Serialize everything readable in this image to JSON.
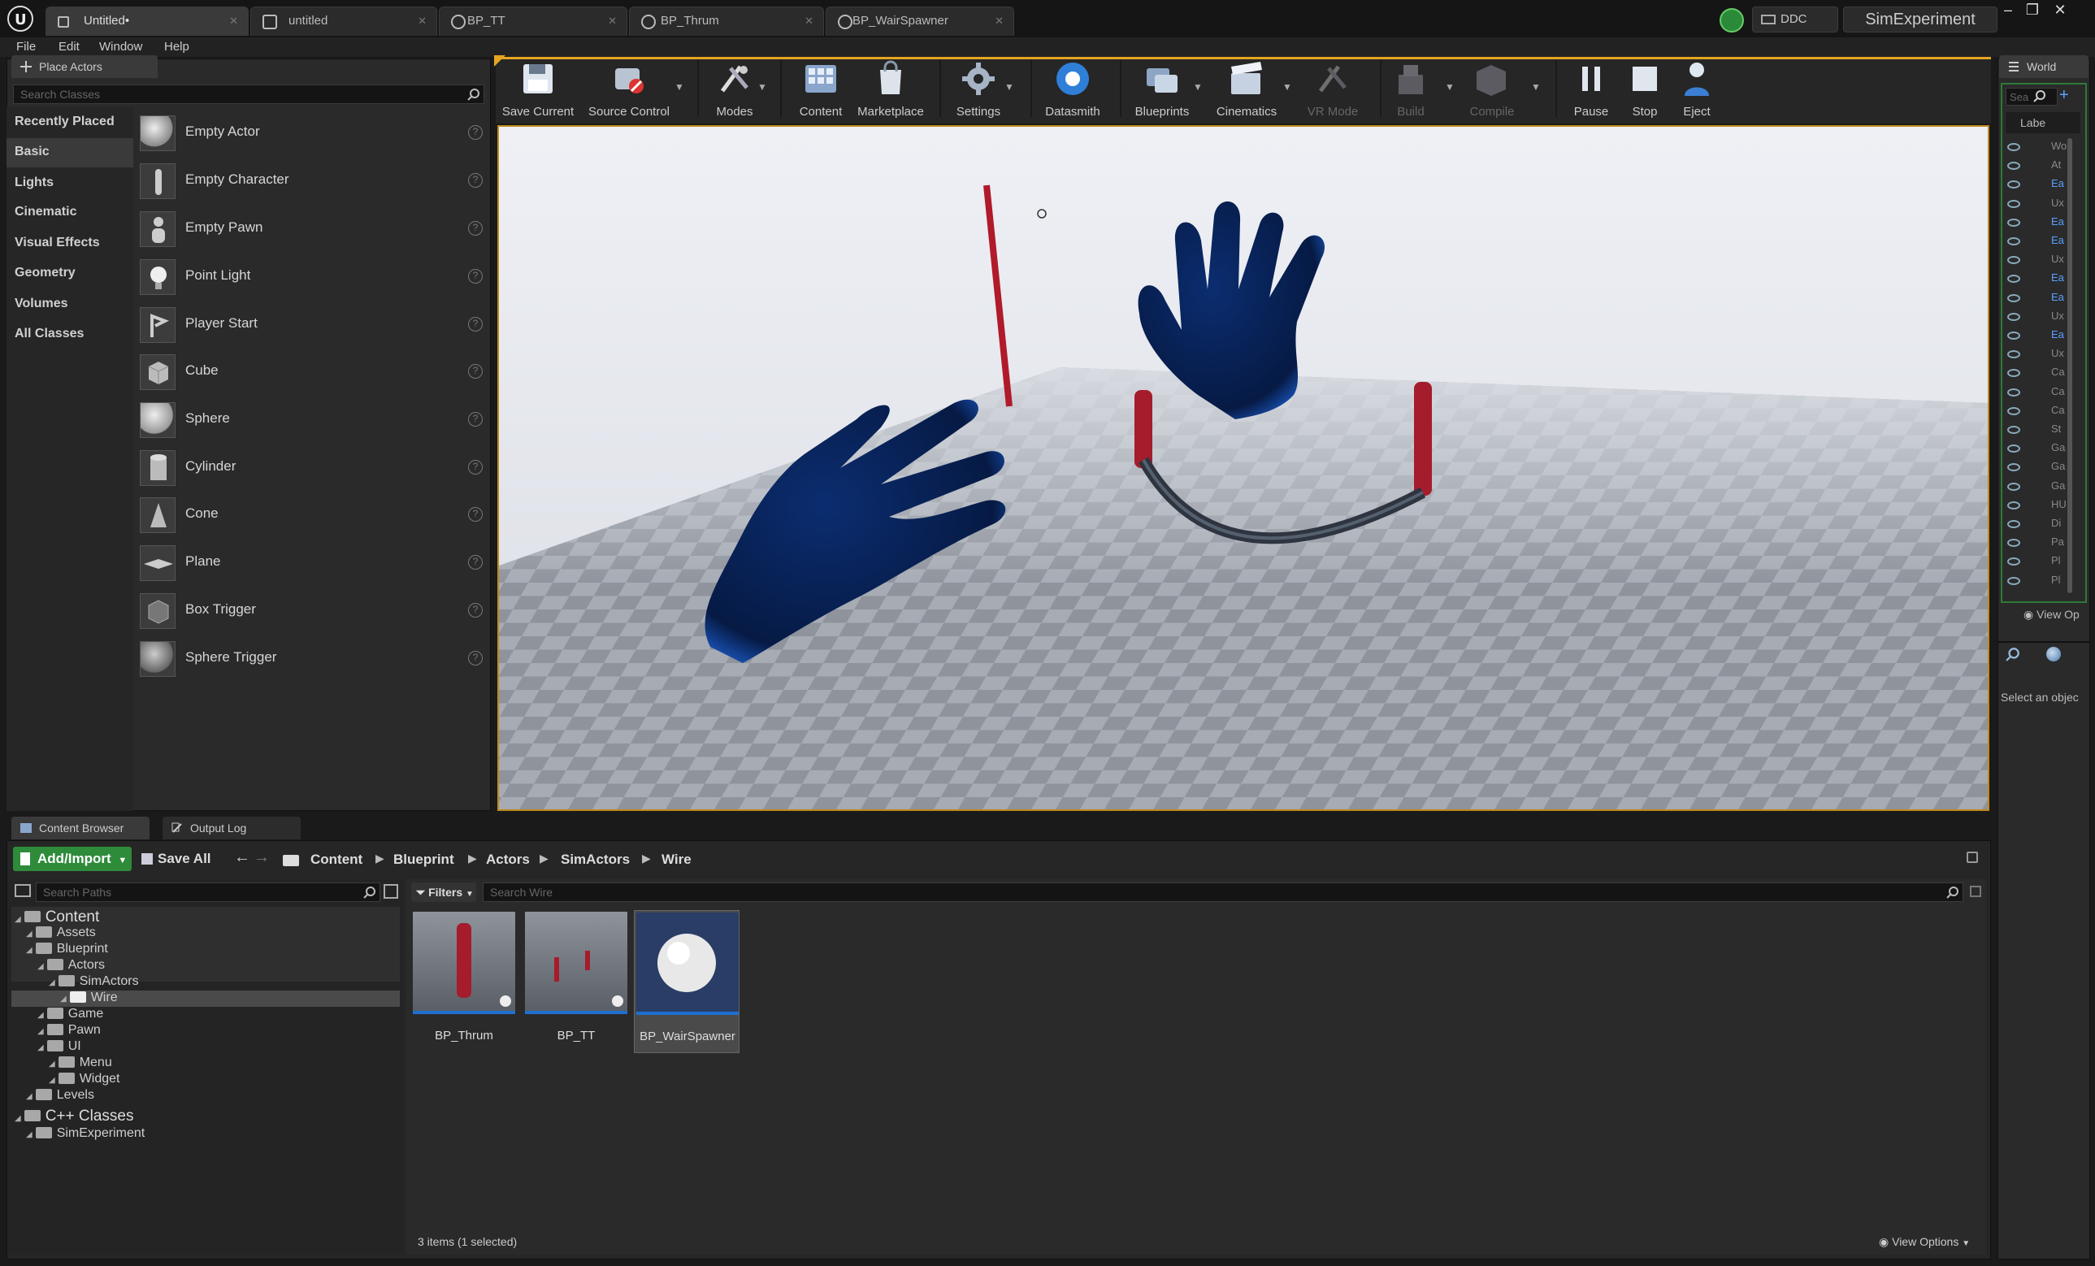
{
  "titlebar": {
    "tabs": [
      {
        "label": "Untitled•",
        "active": true
      },
      {
        "label": "untitled"
      },
      {
        "label": "BP_TT"
      },
      {
        "label": "BP_Thrum"
      },
      {
        "label": "BP_WairSpawner"
      }
    ],
    "ddc_label": "DDC",
    "project_name": "SimExperiment",
    "window_buttons": [
      "–",
      "❐",
      "✕"
    ]
  },
  "menu": [
    "File",
    "Edit",
    "Window",
    "Help"
  ],
  "place_actors": {
    "tab_label": "Place Actors",
    "search_placeholder": "Search Classes",
    "categories": [
      "Recently Placed",
      "Basic",
      "Lights",
      "Cinematic",
      "Visual Effects",
      "Geometry",
      "Volumes",
      "All Classes"
    ],
    "selected_category": "Basic",
    "items": [
      "Empty Actor",
      "Empty Character",
      "Empty Pawn",
      "Point Light",
      "Player Start",
      "Cube",
      "Sphere",
      "Cylinder",
      "Cone",
      "Plane",
      "Box Trigger",
      "Sphere Trigger"
    ]
  },
  "toolbar": {
    "buttons": [
      {
        "label": "Save Current",
        "icon": "save-icon"
      },
      {
        "label": "Source Control",
        "icon": "source-control-icon"
      },
      {
        "label": "Modes",
        "icon": "modes-icon"
      },
      {
        "label": "Content",
        "icon": "content-icon"
      },
      {
        "label": "Marketplace",
        "icon": "marketplace-icon"
      },
      {
        "label": "Settings",
        "icon": "settings-icon"
      },
      {
        "label": "Datasmith",
        "icon": "datasmith-icon"
      },
      {
        "label": "Blueprints",
        "icon": "blueprints-icon"
      },
      {
        "label": "Cinematics",
        "icon": "cinematics-icon"
      },
      {
        "label": "VR Mode",
        "icon": "vr-mode-icon"
      },
      {
        "label": "Build",
        "icon": "build-icon"
      },
      {
        "label": "Compile",
        "icon": "compile-icon"
      },
      {
        "label": "Pause",
        "icon": "pause-icon"
      },
      {
        "label": "Stop",
        "icon": "stop-icon"
      },
      {
        "label": "Eject",
        "icon": "eject-icon"
      }
    ]
  },
  "world_outliner": {
    "tab_label": "World",
    "search_placeholder": "Sea",
    "column_label": "Labe",
    "rows": [
      "Wo",
      "At",
      "Ea",
      "Ux",
      "Ea",
      "Ea",
      "Ux",
      "Ea",
      "Ea",
      "Ux",
      "Ea",
      "Ux",
      "Ca",
      "Ca",
      "Ca",
      "St",
      "Ga",
      "Ga",
      "Ga",
      "HU",
      "Di",
      "Pa",
      "Pl",
      "Pl"
    ],
    "view_options": "View Op",
    "details_hint": "Select an objec"
  },
  "content_browser": {
    "tabs": [
      "Content Browser",
      "Output Log"
    ],
    "add_import": "Add/Import",
    "save_all": "Save All",
    "breadcrumb": [
      "Content",
      "Blueprint",
      "Actors",
      "SimActors",
      "Wire"
    ],
    "search_paths_placeholder": "Search Paths",
    "filters_label": "Filters",
    "search_placeholder": "Search Wire",
    "tree": [
      {
        "label": "Content",
        "level": 0,
        "root": true
      },
      {
        "label": "Assets",
        "level": 1
      },
      {
        "label": "Blueprint",
        "level": 1
      },
      {
        "label": "Actors",
        "level": 2
      },
      {
        "label": "SimActors",
        "level": 3
      },
      {
        "label": "Wire",
        "level": 4,
        "selected": true
      },
      {
        "label": "Game",
        "level": 2
      },
      {
        "label": "Pawn",
        "level": 2
      },
      {
        "label": "UI",
        "level": 2
      },
      {
        "label": "Menu",
        "level": 3
      },
      {
        "label": "Widget",
        "level": 3
      },
      {
        "label": "Levels",
        "level": 1
      },
      {
        "label": "C++ Classes",
        "level": 0,
        "root": true
      },
      {
        "label": "SimExperiment",
        "level": 1
      }
    ],
    "assets": [
      {
        "label": "BP_Thrum"
      },
      {
        "label": "BP_TT"
      },
      {
        "label": "BP_WairSpawner",
        "selected": true
      }
    ],
    "status": "3 items (1 selected)",
    "view_options": "View Options"
  },
  "colors": {
    "accent_orange": "#e6a520",
    "hand_blue": "#0a2a66",
    "wire_red": "#b01a2a",
    "add_import_green": "#2e8b3a"
  }
}
